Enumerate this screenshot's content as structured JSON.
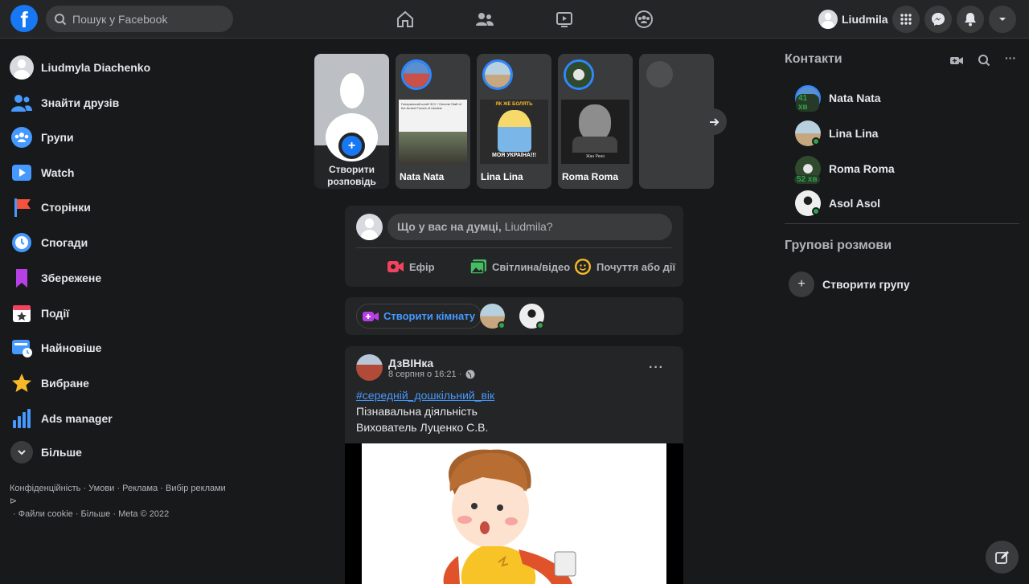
{
  "topbar": {
    "logo": "f",
    "search_placeholder": "Пошук у Facebook",
    "profile_name": "Liudmila"
  },
  "sidebar": {
    "user_name": "Liudmyla Diachenko",
    "items": [
      {
        "label": "Знайти друзів",
        "icon": "friends-icon"
      },
      {
        "label": "Групи",
        "icon": "groups-icon"
      },
      {
        "label": "Watch",
        "icon": "watch-icon"
      },
      {
        "label": "Сторінки",
        "icon": "pages-icon"
      },
      {
        "label": "Спогади",
        "icon": "memories-icon"
      },
      {
        "label": "Збережене",
        "icon": "saved-icon"
      },
      {
        "label": "Події",
        "icon": "events-icon"
      },
      {
        "label": "Найновіше",
        "icon": "recent-icon"
      },
      {
        "label": "Вибране",
        "icon": "favorites-icon"
      },
      {
        "label": "Ads manager",
        "icon": "ads-manager-icon"
      }
    ],
    "more_label": "Більше",
    "footer_line1": "Конфіденційність · Умови · Реклама · Вибір реклами",
    "footer_line2": "· Файли cookie · Більше · Meta © 2022"
  },
  "stories": {
    "create_label_1": "Створити",
    "create_label_2": "розповідь",
    "items": [
      {
        "name": "Nata Nata",
        "thumb_text": "Генеральний штаб ЗСУ / General Staff of the Armed Forces of Ukraine"
      },
      {
        "name": "Lina Lina",
        "thumb_text_top": "ЯК ЖЕ БОЛЯТЬ",
        "thumb_text_bottom": "МОЯ УКРАЇНА!!!"
      },
      {
        "name": "Roma Roma",
        "thumb_text": "Жан Рено"
      }
    ]
  },
  "composer": {
    "prompt": "Що у вас на думці,",
    "prompt_name": "Liudmila?",
    "actions": [
      {
        "label": "Ефір",
        "color": "#f3425f"
      },
      {
        "label": "Світлина/відео",
        "color": "#45bd62"
      },
      {
        "label": "Почуття або дії",
        "color": "#f7b928"
      }
    ]
  },
  "rooms": {
    "create_label": "Створити кімнату"
  },
  "post": {
    "author": "ДзВІНка",
    "time": "8 серпня о 16:21 ·",
    "hashtag": "#середній_дошкільний_вік",
    "line1": "Пізнавальна діяльність",
    "line2": "Вихователь Луценко С.В.",
    "more": "···"
  },
  "contacts": {
    "title": "Контакти",
    "items": [
      {
        "name": "Nata Nata",
        "badge": "41 хв"
      },
      {
        "name": "Lina Lina",
        "badge": ""
      },
      {
        "name": "Roma Roma",
        "badge": "52 хв"
      },
      {
        "name": "Asol Asol",
        "badge": ""
      }
    ],
    "group_title": "Групові розмови",
    "create_group": "Створити групу",
    "more": "···"
  },
  "colors": {
    "accent": "#1877f2",
    "bg": "#18191a",
    "card": "#242526",
    "online": "#31a24c"
  }
}
